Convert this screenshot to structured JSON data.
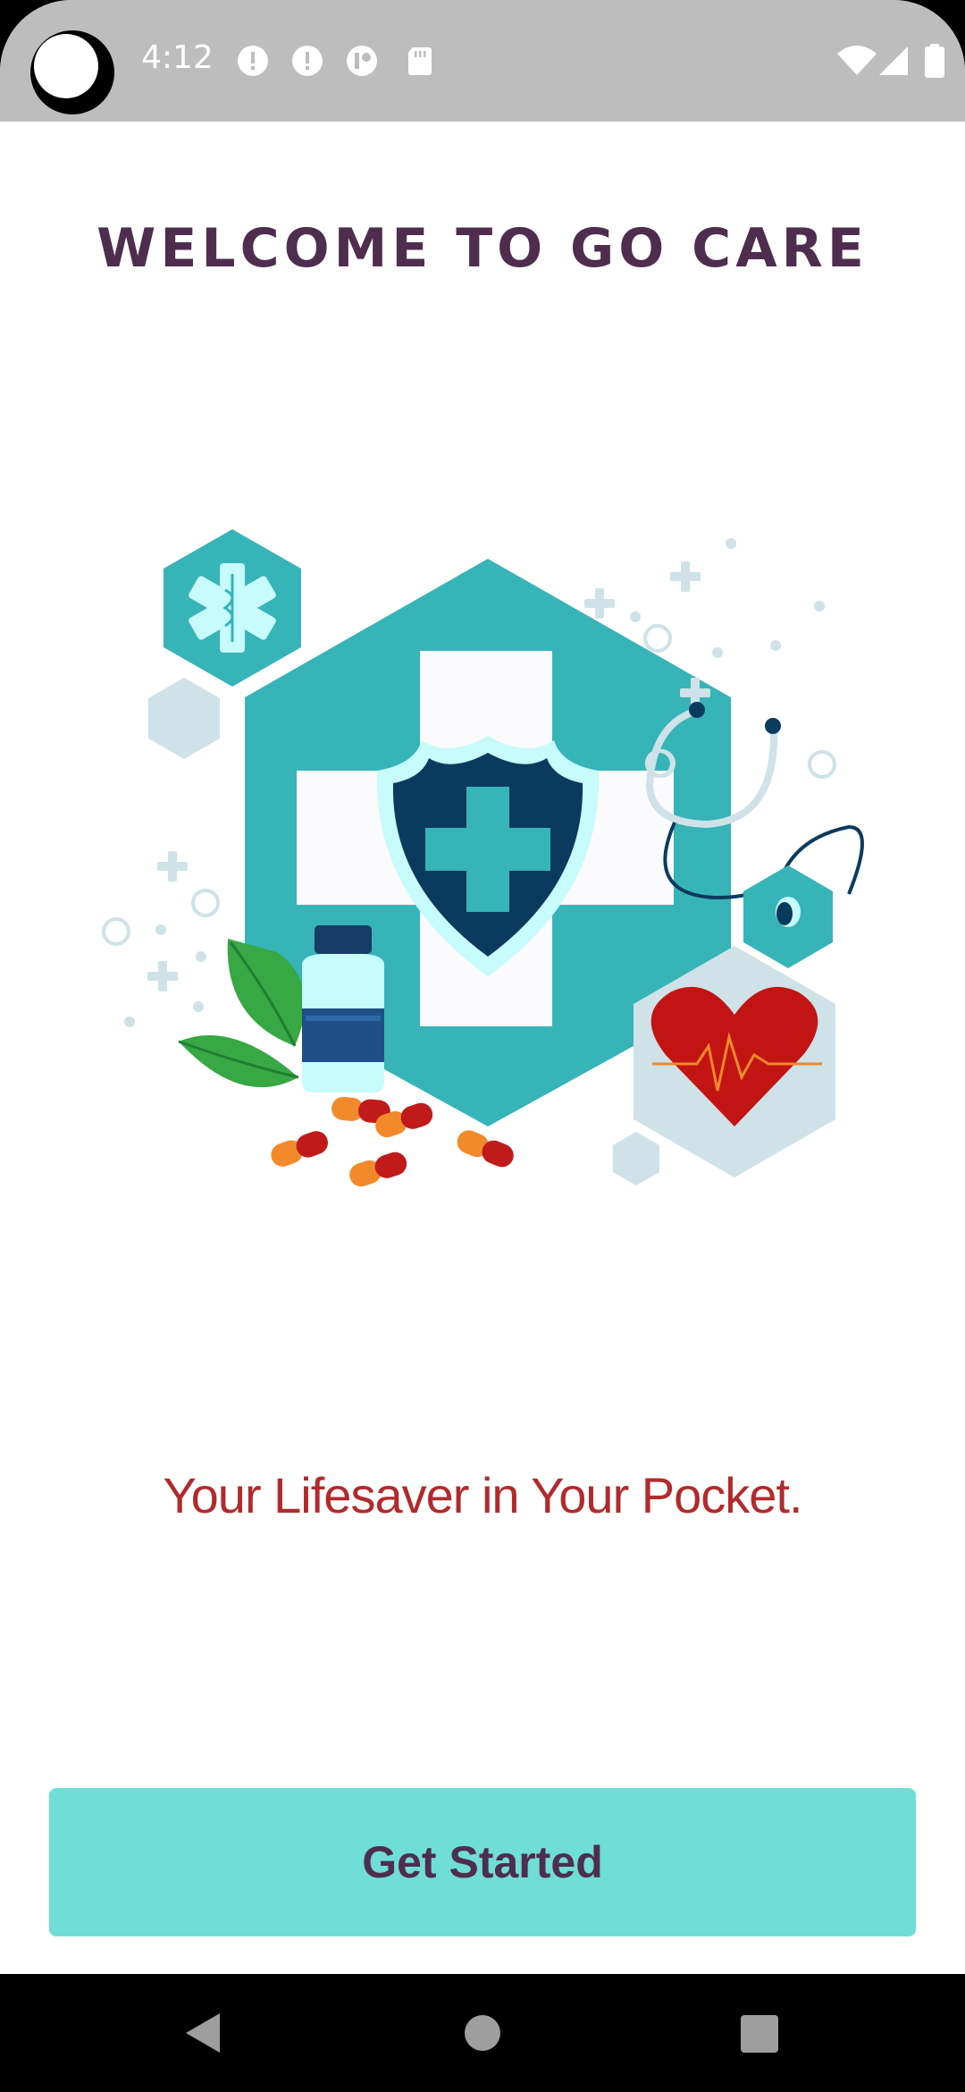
{
  "status_bar": {
    "time": "4:12",
    "icons": [
      "alert-circle-icon",
      "alert-circle-icon",
      "app-notification-icon",
      "sd-card-icon",
      "wifi-icon",
      "cell-signal-icon",
      "battery-icon"
    ]
  },
  "welcome": {
    "title": "WELCOME TO GO CARE",
    "tagline": "Your Lifesaver in Your Pocket."
  },
  "actions": {
    "get_started_label": "Get Started"
  },
  "nav_bar": {
    "buttons": [
      "back-icon",
      "home-icon",
      "recents-icon"
    ]
  },
  "colors": {
    "title": "#4e2d4e",
    "tagline": "#b22a2c",
    "button_bg": "#6fded6",
    "teal": "#36b4b8",
    "navy": "#0b3a5f",
    "heart_red": "#c31414"
  }
}
